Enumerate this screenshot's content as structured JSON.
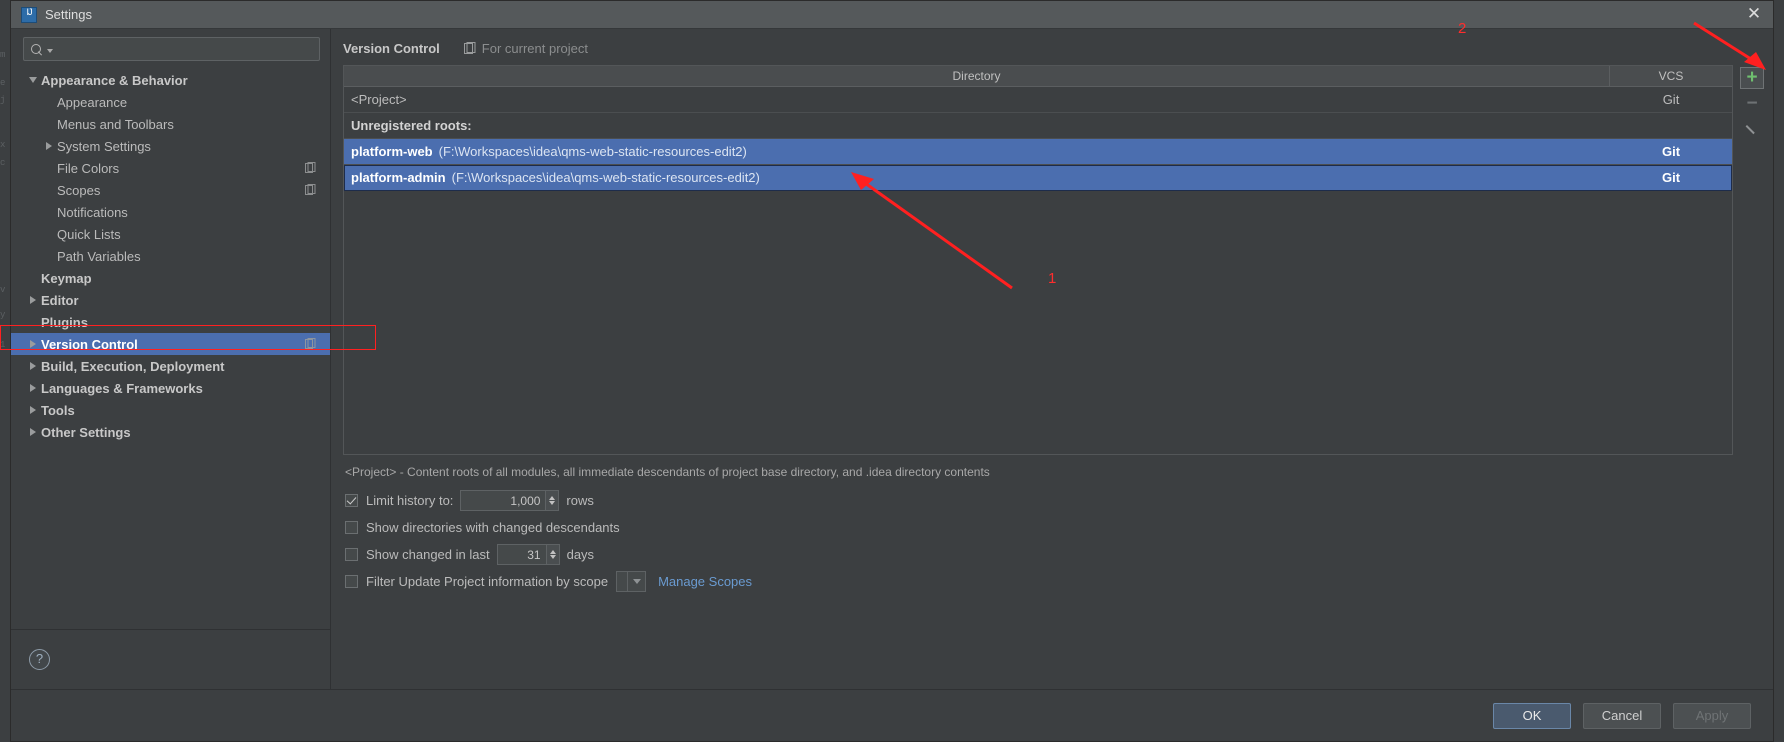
{
  "window": {
    "title": "Settings",
    "app_icon": "intellij-idea-icon",
    "close_icon": "close-icon"
  },
  "search": {
    "value": "",
    "placeholder": "",
    "icon": "search-icon",
    "dropdown_icon": "chevron-down-icon"
  },
  "sidebar": {
    "items": [
      {
        "label": "Appearance & Behavior",
        "level": 0,
        "bold": true,
        "twisty": "down",
        "selected": false,
        "badge": false
      },
      {
        "label": "Appearance",
        "level": 1,
        "bold": false,
        "twisty": "none",
        "selected": false,
        "badge": false
      },
      {
        "label": "Menus and Toolbars",
        "level": 1,
        "bold": false,
        "twisty": "none",
        "selected": false,
        "badge": false
      },
      {
        "label": "System Settings",
        "level": 1,
        "bold": false,
        "twisty": "right",
        "selected": false,
        "badge": false
      },
      {
        "label": "File Colors",
        "level": 1,
        "bold": false,
        "twisty": "none",
        "selected": false,
        "badge": true
      },
      {
        "label": "Scopes",
        "level": 1,
        "bold": false,
        "twisty": "none",
        "selected": false,
        "badge": true
      },
      {
        "label": "Notifications",
        "level": 1,
        "bold": false,
        "twisty": "none",
        "selected": false,
        "badge": false
      },
      {
        "label": "Quick Lists",
        "level": 1,
        "bold": false,
        "twisty": "none",
        "selected": false,
        "badge": false
      },
      {
        "label": "Path Variables",
        "level": 1,
        "bold": false,
        "twisty": "none",
        "selected": false,
        "badge": false
      },
      {
        "label": "Keymap",
        "level": 0,
        "bold": true,
        "twisty": "none",
        "selected": false,
        "badge": false
      },
      {
        "label": "Editor",
        "level": 0,
        "bold": true,
        "twisty": "right",
        "selected": false,
        "badge": false
      },
      {
        "label": "Plugins",
        "level": 0,
        "bold": true,
        "twisty": "none",
        "selected": false,
        "badge": false
      },
      {
        "label": "Version Control",
        "level": 0,
        "bold": true,
        "twisty": "right",
        "selected": true,
        "badge": true
      },
      {
        "label": "Build, Execution, Deployment",
        "level": 0,
        "bold": true,
        "twisty": "right",
        "selected": false,
        "badge": false
      },
      {
        "label": "Languages & Frameworks",
        "level": 0,
        "bold": true,
        "twisty": "right",
        "selected": false,
        "badge": false
      },
      {
        "label": "Tools",
        "level": 0,
        "bold": true,
        "twisty": "right",
        "selected": false,
        "badge": false
      },
      {
        "label": "Other Settings",
        "level": 0,
        "bold": true,
        "twisty": "right",
        "selected": false,
        "badge": false
      }
    ],
    "help_button": "?"
  },
  "content": {
    "title": "Version Control",
    "scope_icon": "project-scope-icon",
    "scope_label": "For current project",
    "table": {
      "columns": [
        "Directory",
        "VCS"
      ],
      "rows": [
        {
          "kind": "plain",
          "name": "<Project>",
          "path": "",
          "vcs": "Git",
          "selected": false,
          "focused": false
        },
        {
          "kind": "group",
          "name": "Unregistered roots:",
          "path": "",
          "vcs": "",
          "selected": false,
          "focused": false
        },
        {
          "kind": "root",
          "name": "platform-web",
          "path": "(F:\\Workspaces\\idea\\qms-web-static-resources-edit2)",
          "vcs": "Git",
          "selected": true,
          "focused": false
        },
        {
          "kind": "root",
          "name": "platform-admin",
          "path": "(F:\\Workspaces\\idea\\qms-web-static-resources-edit2)",
          "vcs": "Git",
          "selected": true,
          "focused": true
        }
      ]
    },
    "toolbar": {
      "add_icon": "plus-icon",
      "remove_icon": "minus-icon",
      "edit_icon": "pencil-icon"
    },
    "hint": "<Project> - Content roots of all modules, all immediate descendants of project base directory, and .idea directory contents",
    "options": {
      "limit_history": {
        "label": "Limit history to:",
        "checked": true,
        "value": "1,000",
        "suffix": "rows"
      },
      "show_dirs_changed_descendants": {
        "label": "Show directories with changed descendants",
        "checked": false
      },
      "show_changed_in_last": {
        "label": "Show changed in last",
        "checked": false,
        "value": "31",
        "suffix": "days"
      },
      "filter_update_by_scope": {
        "label": "Filter Update Project information by scope",
        "checked": false,
        "scope_value": "",
        "manage_link": "Manage Scopes"
      }
    }
  },
  "buttons": {
    "ok": "OK",
    "cancel": "Cancel",
    "apply": "Apply"
  },
  "annotations": [
    {
      "id": "1",
      "label": "1"
    },
    {
      "id": "2",
      "label": "2"
    }
  ],
  "colors": {
    "selection_blue": "#4b6eaf",
    "annotation_red": "#ff2020",
    "link_blue": "#6a9bd1",
    "plus_green": "#6fbf6f",
    "panel_bg": "#3c3f41",
    "titlebar_bg": "#55595b"
  }
}
